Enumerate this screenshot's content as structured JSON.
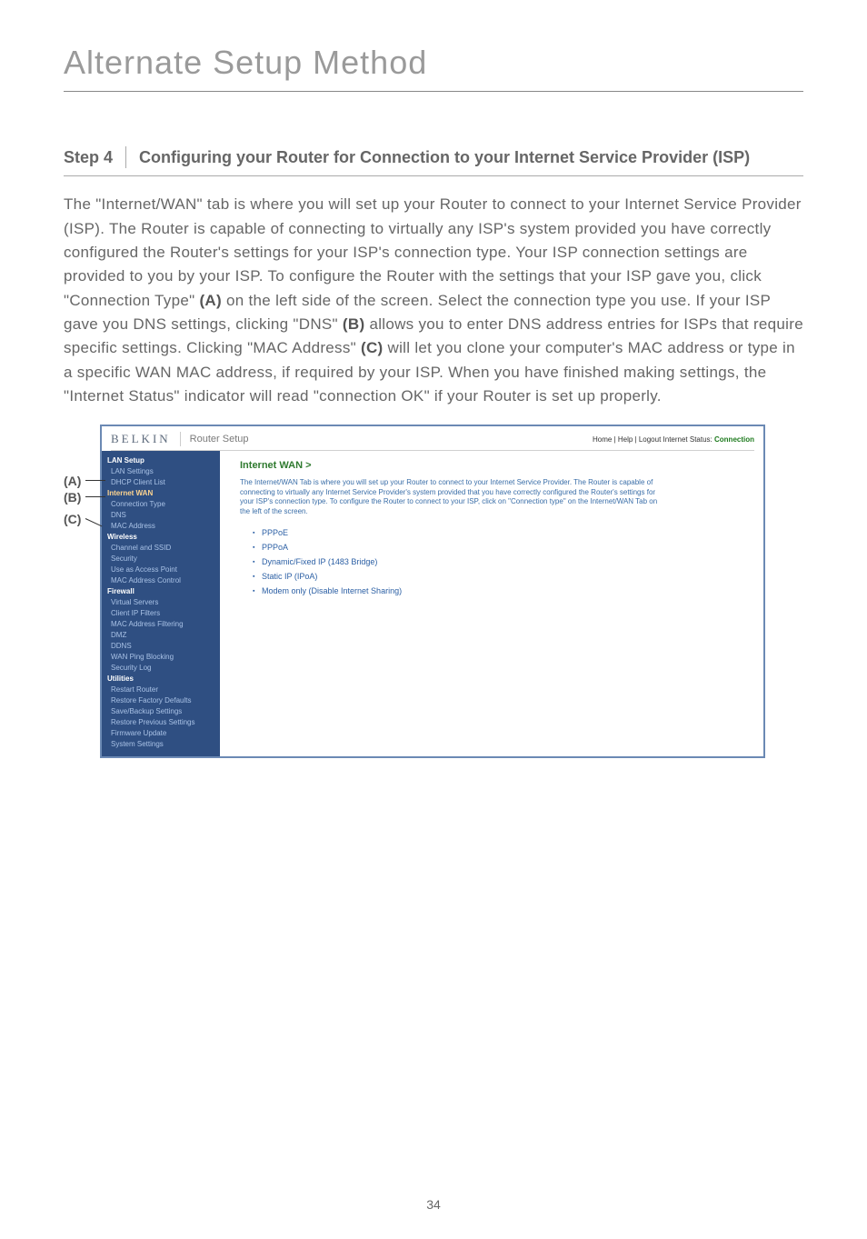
{
  "page": {
    "title": "Alternate Setup Method",
    "number": "34"
  },
  "step": {
    "label": "Step 4",
    "heading": "Configuring your Router for Connection to your Internet Service Provider (ISP)"
  },
  "body": {
    "p1a": "The \"Internet/WAN\" tab is where you will set up your Router to connect to your Internet Service Provider (ISP). The Router is capable of connecting to virtually any ISP's system provided you have correctly configured the Router's settings for your ISP's connection type. Your ISP connection settings are provided to you by your ISP. To configure the Router with the settings that your ISP gave you, click \"Connection Type\" ",
    "ref_a": "(A)",
    "p1b": " on the left side of the screen. Select the connection type you use. If your ISP gave you DNS settings, clicking \"DNS\" ",
    "ref_b": "(B)",
    "p1c": " allows you to enter DNS address entries for ISPs that require specific settings. Clicking \"MAC Address\" ",
    "ref_c": "(C)",
    "p1d": " will let you clone your computer's MAC address or type in a specific WAN MAC address, if required by your ISP. When you have finished making settings, the \"Internet Status\" indicator will read \"connection OK\" if your Router is set up properly."
  },
  "callouts": {
    "a": "(A)",
    "b": "(B)",
    "c": "(C)"
  },
  "shot": {
    "brand": "BELKIN",
    "title": "Router Setup",
    "links_prefix": "Home | Help | Logout   Internet Status: ",
    "links_status": "Connection",
    "nav": {
      "s1": "LAN Setup",
      "s1a": "LAN Settings",
      "s1b": "DHCP Client List",
      "s2": "Internet WAN",
      "s2a": "Connection Type",
      "s2b": "DNS",
      "s2c": "MAC Address",
      "s3": "Wireless",
      "s3a": "Channel and SSID",
      "s3b": "Security",
      "s3c": "Use as Access Point",
      "s3d": "MAC Address Control",
      "s4": "Firewall",
      "s4a": "Virtual Servers",
      "s4b": "Client IP Filters",
      "s4c": "MAC Address Filtering",
      "s4d": "DMZ",
      "s4e": "DDNS",
      "s4f": "WAN Ping Blocking",
      "s4g": "Security Log",
      "s5": "Utilities",
      "s5a": "Restart Router",
      "s5b": "Restore Factory Defaults",
      "s5c": "Save/Backup Settings",
      "s5d": "Restore Previous Settings",
      "s5e": "Firmware Update",
      "s5f": "System Settings"
    },
    "content": {
      "heading": "Internet WAN >",
      "desc": "The Internet/WAN Tab is where you will set up your Router to connect to your Internet Service Provider. The Router is capable of connecting to virtually any Internet Service Provider's system provided that you have correctly configured the Router's settings for your ISP's connection type. To configure the Router to connect to your ISP, click on \"Connection type\" on the Internet/WAN Tab on the left of the screen.",
      "opt1": "PPPoE",
      "opt2": "PPPoA",
      "opt3": "Dynamic/Fixed IP (1483 Bridge)",
      "opt4": "Static IP (IPoA)",
      "opt5": "Modem only (Disable Internet Sharing)"
    }
  }
}
